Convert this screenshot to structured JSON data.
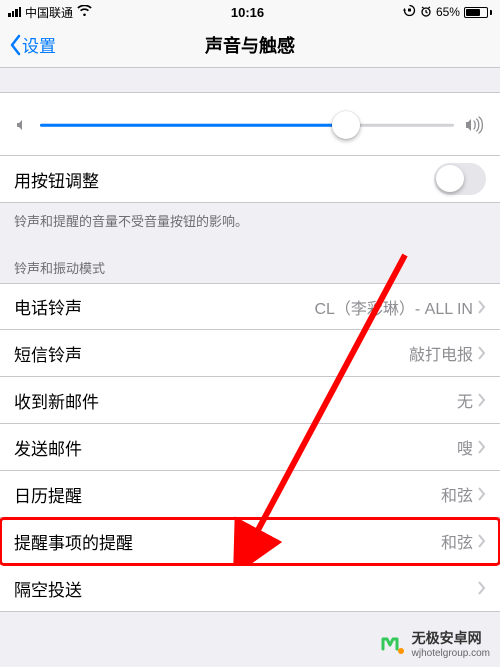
{
  "status": {
    "carrier": "中国联通",
    "time": "10:16",
    "battery_pct": "65%"
  },
  "nav": {
    "back": "设置",
    "title": "声音与触感"
  },
  "volume": {
    "value_pct": 74
  },
  "rows": {
    "useButtons": {
      "label": "用按钮调整"
    },
    "footer1": "铃声和提醒的音量不受音量按钮的影响。",
    "sectionHeader": "铃声和振动模式",
    "ringtone": {
      "label": "电话铃声",
      "value": "CL（李彩琳）- ALL IN"
    },
    "textTone": {
      "label": "短信铃声",
      "value": "敲打电报"
    },
    "newMail": {
      "label": "收到新邮件",
      "value": "无"
    },
    "sentMail": {
      "label": "发送邮件",
      "value": "嗖"
    },
    "calendar": {
      "label": "日历提醒",
      "value": "和弦"
    },
    "reminders": {
      "label": "提醒事项的提醒",
      "value": "和弦"
    },
    "airdrop": {
      "label": "隔空投送",
      "value": ""
    }
  },
  "watermark": {
    "brand": "无极安卓网",
    "url": "wjhotelgroup.com"
  }
}
